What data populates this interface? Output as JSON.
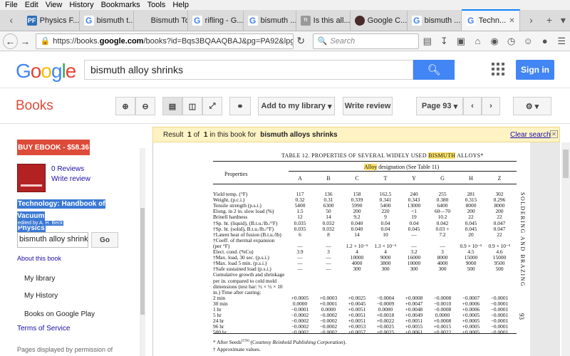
{
  "menu": [
    "File",
    "Edit",
    "View",
    "History",
    "Bookmarks",
    "Tools",
    "Help"
  ],
  "tabs": [
    {
      "label": "Physics F...",
      "icon": "pf"
    },
    {
      "label": "bismuth t...",
      "icon": "g"
    },
    {
      "label": "Bismuth Toxi...",
      "icon": "none"
    },
    {
      "label": "rifling - G...",
      "icon": "g"
    },
    {
      "label": "bismuth ...",
      "icon": "g"
    },
    {
      "label": "Is this all...",
      "icon": "ti"
    },
    {
      "label": "Google C...",
      "icon": "gc"
    },
    {
      "label": "bismuth ...",
      "icon": "g"
    },
    {
      "label": "Techn...",
      "icon": "g"
    }
  ],
  "url": {
    "prefix": "https://books.",
    "domain": "google.com",
    "rest": "/books?id=Bqs3BQAAQBAJ&pg=PA92&lpg=PA92&dc"
  },
  "search_placeholder": "Search",
  "google": {
    "logo": "Google",
    "query": "bismuth alloy shrinks",
    "signin": "Sign in"
  },
  "books": {
    "title": "Books",
    "add_library": "Add to my library",
    "write_review": "Write review",
    "page": "Page 93"
  },
  "sidebar": {
    "buy": "BUY EBOOK - $58.36",
    "reviews": "0 Reviews",
    "write_review": "Write review",
    "book_title_1": "Technology: Handbook of Vacuum",
    "book_title_2": "Physics",
    "edited_by": "edited by A. H. Beck",
    "search_value": "bismuth alloy shrinks",
    "go": "Go",
    "about": "About this book",
    "links": [
      "My library",
      "My History",
      "Books on Google Play"
    ],
    "terms": "Terms of Service",
    "pages_displayed": "Pages displayed by permission of"
  },
  "result": {
    "pre": "Result",
    "n": "1",
    "of": "of",
    "total": "1",
    "mid": "in this book for",
    "query": "bismuth alloys shrinks",
    "clear": "Clear search"
  },
  "doc": {
    "caption_pre": "TABLE 12.  PROPERTIES OF SEVERAL WIDELY USED ",
    "caption_hl": "BISMUTH",
    "caption_post": " ALLOYS*",
    "properties": "Properties",
    "designation_hl": "Alloy",
    "designation_post": " designation (See Table 11)",
    "columns": [
      "A",
      "B",
      "C",
      "T",
      "Y",
      "G",
      "H",
      "Z"
    ],
    "rows": [
      {
        "label": "Yield temp. (°F)",
        "v": [
          "117",
          "136",
          "158",
          "162.5",
          "240",
          "255",
          "281",
          "302"
        ]
      },
      {
        "label": "Weight, (p.c.i.)",
        "v": [
          "0.32",
          "0.31",
          "0.339",
          "0.341",
          "0.343",
          "0.380",
          "0.315",
          "0.296"
        ]
      },
      {
        "label": "Tensile strength (p.s.i.)",
        "v": [
          "5400",
          "6300",
          "5990",
          "5400",
          "13000",
          "6400",
          "8000",
          "8000"
        ]
      },
      {
        "label": "Elong. in 2 in. slow load (%)",
        "v": [
          "1.5",
          "50",
          "200",
          "220",
          "<1",
          "60—70",
          "200",
          "200"
        ]
      },
      {
        "label": "Brinell hardness",
        "v": [
          "12",
          "14",
          "9.2",
          "9",
          "19",
          "10.2",
          "22",
          "22"
        ]
      },
      {
        "label": "†Sp. ht. (liquid), (B.t.u./lb./°F)",
        "v": [
          "0.035",
          "0.032",
          "0.040",
          "0.04",
          "0.04",
          "0.042",
          "0.045",
          "0.047"
        ]
      },
      {
        "label": "†Sp. ht. (solid), B.t.u./lb./°F)",
        "v": [
          "0.035",
          "0.032",
          "0.040",
          "0.04",
          "0.045",
          "0.03 +",
          "0.045",
          "0.047"
        ]
      },
      {
        "label": "†Latent heat of fusion (B.t.u./lb)",
        "v": [
          "6",
          "8",
          "14",
          "10",
          "—",
          "7.2",
          "20",
          "22"
        ]
      },
      {
        "label": "†Coeff. of thermal expansion",
        "v": [
          "",
          "",
          "",
          "",
          "",
          "",
          "",
          ""
        ]
      },
      {
        "label": "   (per °F)",
        "v": [
          "—",
          "—",
          "1.2 × 10⁻⁵",
          "1.3 × 10⁻⁵",
          "—",
          "—",
          "0.9 × 10⁻⁵",
          "0.9 × 10⁻⁵"
        ]
      },
      {
        "label": "Elect. cond. (%Cu)",
        "v": [
          "3.9",
          "3",
          "4",
          "4",
          "3.2",
          "3",
          "4.5",
          "4.6"
        ]
      },
      {
        "label": "†Max. load, 30 sec. (p.s.i.)",
        "v": [
          "—",
          "—",
          "10000",
          "9000",
          "16000",
          "8000",
          "15000",
          "15000"
        ]
      },
      {
        "label": "†Max. load 5 min. (p.s.i.)",
        "v": [
          "—",
          "—",
          "4000",
          "3800",
          "10000",
          "4000",
          "9000",
          "9500"
        ]
      },
      {
        "label": "†Safe sustained load (p.s.i.)",
        "v": [
          "—",
          "—",
          "300",
          "300",
          "300",
          "300",
          "500",
          "500"
        ]
      },
      {
        "label": "Cumulative growth and shrinkage",
        "v": [
          "",
          "",
          "",
          "",
          "",
          "",
          "",
          ""
        ]
      },
      {
        "label": "  per in. compared to cold mold",
        "v": [
          "",
          "",
          "",
          "",
          "",
          "",
          "",
          ""
        ]
      },
      {
        "label": "  dimensions (test bar: ½ × ½ × 10",
        "v": [
          "",
          "",
          "",
          "",
          "",
          "",
          "",
          ""
        ]
      },
      {
        "label": "  in.)  Time after casting:",
        "v": [
          "",
          "",
          "",
          "",
          "",
          "",
          "",
          ""
        ]
      },
      {
        "label": "        2 min",
        "v": [
          "+0.0005",
          "+0.0003",
          "+0.0025",
          "−0.0004",
          "+0.0008",
          "−0.0008",
          "−0.0007",
          "−0.0001"
        ]
      },
      {
        "label": "        30 min",
        "v": [
          "0.0000",
          "+0.0001",
          "+0.0045",
          "−0.0009",
          "+0.0047",
          "−0.0010",
          "+0.0006",
          "−0.0001"
        ]
      },
      {
        "label": "        1 hr",
        "v": [
          "−0.0001",
          "0.0000",
          "+0.0051",
          "0.0000",
          "+0.0048",
          "−0.0008",
          "+0.0006",
          "−0.0001"
        ]
      },
      {
        "label": "        5 hr",
        "v": [
          "−0.0002",
          "−0.0002",
          "+0.0051",
          "+0.0018",
          "+0.0049",
          "0.0000",
          "+0.0005",
          "−0.0001"
        ]
      },
      {
        "label": "        24 hr",
        "v": [
          "−0.0002",
          "−0.0002",
          "+0.0051",
          "+0.0022",
          "+0.0051",
          "+0.0008",
          "+0.0005",
          "−0.0001"
        ]
      },
      {
        "label": "        96 hr",
        "v": [
          "−0.0002",
          "−0.0002",
          "+0.0053",
          "+0.0025",
          "+0.0055",
          "+0.0015",
          "+0.0005",
          "−0.0001"
        ]
      },
      {
        "label": "        500 hr",
        "v": [
          "−0.0002",
          "−0.0002",
          "+0.0057",
          "+0.0025",
          "+0.0061",
          "+0.0022",
          "+0.0005",
          "−0.0001"
        ]
      }
    ],
    "footnote1_pre": "* After Seeds",
    "footnote1_sup": "(15b)",
    "footnote1_post": " (Courtesy ",
    "footnote1_em": "Reinhold Publishing Corporation",
    "footnote1_end": ").",
    "footnote2": "† Approximate values.",
    "side_title": "SOLDERING AND BRAZING",
    "page_number": "93"
  }
}
